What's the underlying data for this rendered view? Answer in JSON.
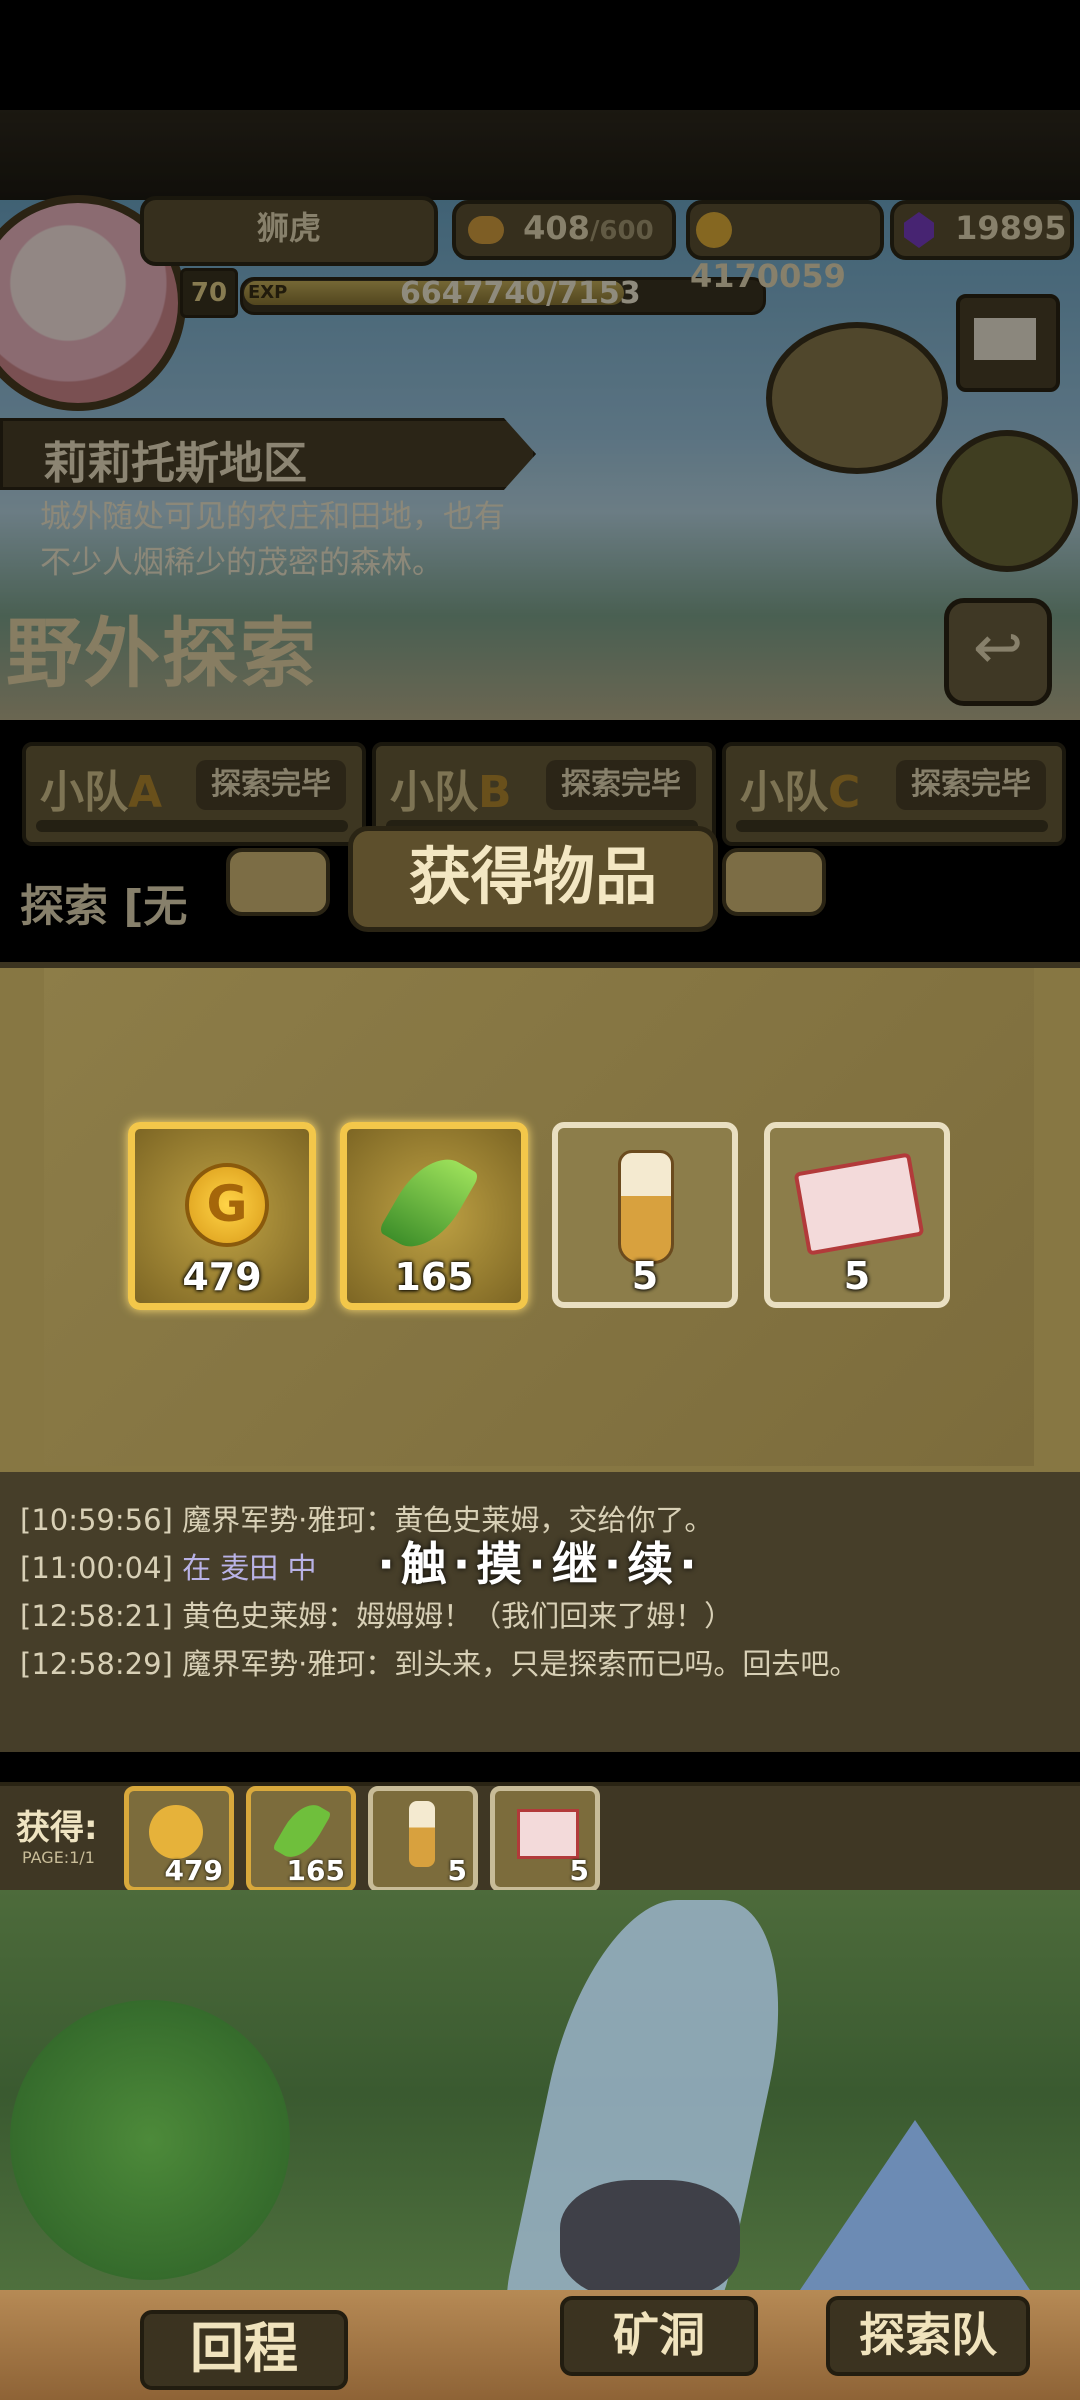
{
  "player": {
    "name": "狮虎",
    "level": "70",
    "exp_label": "EXP",
    "exp_text": "6647740/7153"
  },
  "resources": {
    "stamina_current": "408",
    "stamina_max": "/600",
    "gold": "4170059",
    "gems": "19895"
  },
  "region": {
    "name": "莉莉托斯地区",
    "desc_line1": "城外随处可见的农庄和田地，也有",
    "desc_line2": "不少人烟稀少的茂密的森林。",
    "mode_title": "野外探索"
  },
  "squads": [
    {
      "name_pre": "小队",
      "name_letter": "A",
      "status": "探索完毕"
    },
    {
      "name_pre": "小队",
      "name_letter": "B",
      "status": "探索完毕"
    },
    {
      "name_pre": "小队",
      "name_letter": "C",
      "status": "探索完毕"
    }
  ],
  "explore_label": "探索 [无",
  "modal": {
    "title": "获得物品",
    "touch_continue": "·触·摸·继·续·"
  },
  "items": [
    {
      "icon": "gold-coin-icon",
      "count": "479"
    },
    {
      "icon": "green-feather-icon",
      "count": "165"
    },
    {
      "icon": "potion-bottle-icon",
      "count": "5"
    },
    {
      "icon": "scroll-icon",
      "count": "5"
    }
  ],
  "log": [
    {
      "time": "[10:59:56]",
      "text": "魔界军势·雅珂：黄色史莱姆，交给你了。"
    },
    {
      "time": "[11:00:04]",
      "text": "在 麦田 中"
    },
    {
      "time": "[12:58:21]",
      "text": "黄色史莱姆：姆姆姆！（我们回来了姆！）"
    },
    {
      "time": "[12:58:29]",
      "text": "魔界军势·雅珂：到头来，只是探索而已吗。回去吧。"
    }
  ],
  "obtained": {
    "label": "获得:",
    "page": "PAGE:1/1"
  },
  "bottom": {
    "return": "回程",
    "mine": "矿洞",
    "team": "探索队"
  },
  "colors": {
    "gold_border": "#f3c74a",
    "wood": "#5d5232"
  }
}
